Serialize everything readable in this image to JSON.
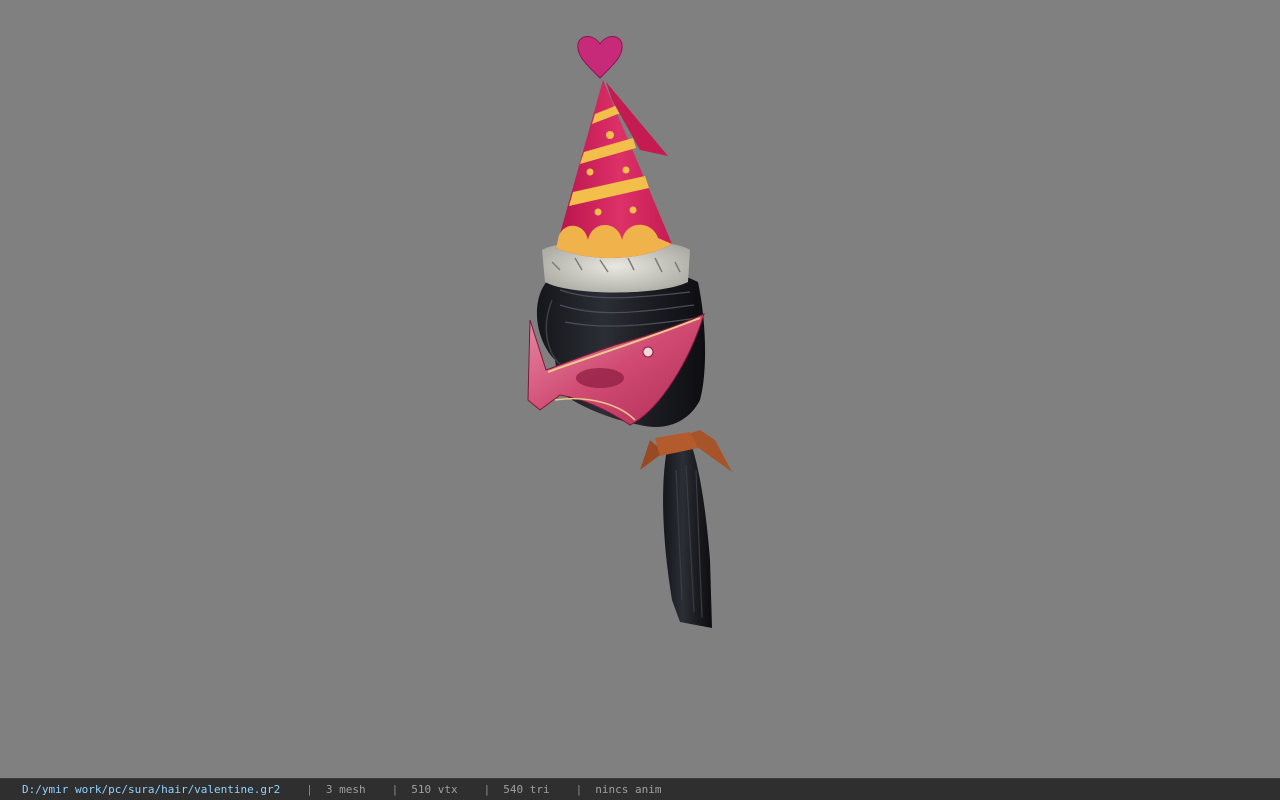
{
  "viewer": {
    "background_color": "#808080",
    "model_name": "sura hair valentine",
    "model_parts": [
      "party-hat",
      "heart-topper",
      "fur-brim",
      "hair",
      "eye-mask",
      "ponytail",
      "ribbon"
    ]
  },
  "status": {
    "file_path": "D:/ymir work/pc/sura/hair/valentine.gr2",
    "separator": "|",
    "mesh_count": "3 mesh",
    "vertex_count": "510 vtx",
    "triangle_count": "540 tri",
    "animation": "nincs anim",
    "path_color": "#8fd2ff",
    "bar_color": "#2f2f2f"
  }
}
